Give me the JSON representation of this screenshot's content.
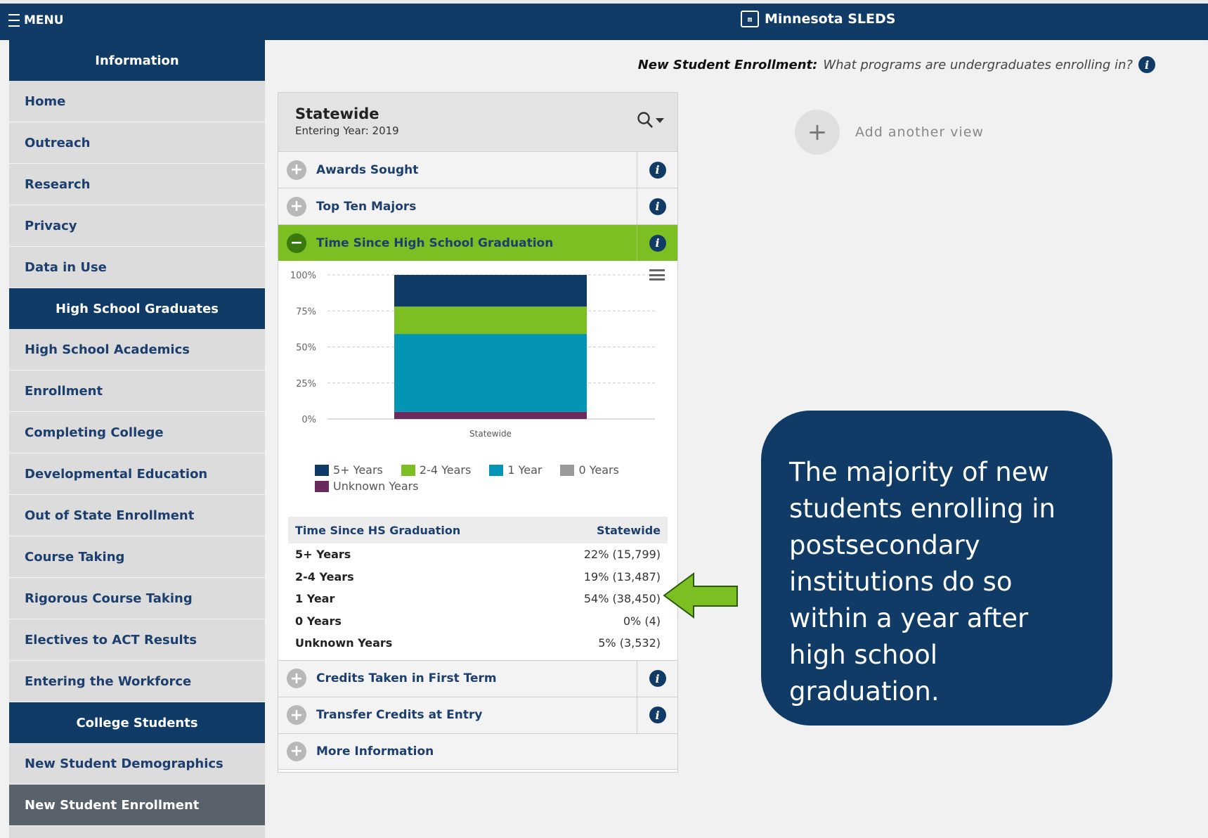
{
  "topbar": {
    "menu_label": "MENU",
    "app_title": "Minnesota SLEDS",
    "logo_glyph": "m"
  },
  "sidebar": {
    "sections": [
      {
        "heading": "Information",
        "items": [
          "Home",
          "Outreach",
          "Research",
          "Privacy",
          "Data in Use"
        ]
      },
      {
        "heading": "High School Graduates",
        "items": [
          "High School Academics",
          "Enrollment",
          "Completing College",
          "Developmental Education",
          "Out of State Enrollment",
          "Course Taking",
          "Rigorous Course Taking",
          "Electives to ACT Results",
          "Entering the Workforce"
        ]
      },
      {
        "heading": "College Students",
        "items": [
          "New Student Demographics",
          "New Student Enrollment"
        ]
      }
    ],
    "active_item": "New Student Enrollment"
  },
  "main": {
    "question_bold": "New Student Enrollment:",
    "question_text": "What programs are undergraduates enrolling in?",
    "info_glyph": "i"
  },
  "panel": {
    "title": "Statewide",
    "subtitle": "Entering Year: 2019",
    "sections": {
      "awards": "Awards Sought",
      "majors": "Top Ten Majors",
      "time": "Time Since High School Graduation",
      "credits": "Credits Taken in First Term",
      "transfer": "Transfer Credits at Entry",
      "more": "More Information"
    },
    "table": {
      "col1": "Time Since HS Graduation",
      "col2": "Statewide",
      "rows": [
        {
          "label": "5+ Years",
          "value": "22% (15,799)"
        },
        {
          "label": "2-4 Years",
          "value": "19% (13,487)"
        },
        {
          "label": "1 Year",
          "value": "54% (38,450)"
        },
        {
          "label": "0 Years",
          "value": "0% (4)"
        },
        {
          "label": "Unknown Years",
          "value": "5% (3,532)"
        }
      ]
    }
  },
  "add_view": {
    "icon": "+",
    "label": "Add another view"
  },
  "callout": {
    "text": "The majority of new students enrolling in postsecondary institutions  do so within a year after high school graduation."
  },
  "chart_data": {
    "type": "bar",
    "stacked": true,
    "categories": [
      "Statewide"
    ],
    "series": [
      {
        "name": "5+ Years",
        "values": [
          22
        ],
        "color": "#0f3b66"
      },
      {
        "name": "2-4 Years",
        "values": [
          19
        ],
        "color": "#7cbf22"
      },
      {
        "name": "1 Year",
        "values": [
          54
        ],
        "color": "#0494b4"
      },
      {
        "name": "0 Years",
        "values": [
          0
        ],
        "color": "#9a9a9a"
      },
      {
        "name": "Unknown Years",
        "values": [
          5
        ],
        "color": "#6b2a5e"
      }
    ],
    "ylim": [
      0,
      100
    ],
    "yticks": [
      "0%",
      "25%",
      "50%",
      "75%",
      "100%"
    ],
    "grid": true,
    "legend": "bottom"
  }
}
